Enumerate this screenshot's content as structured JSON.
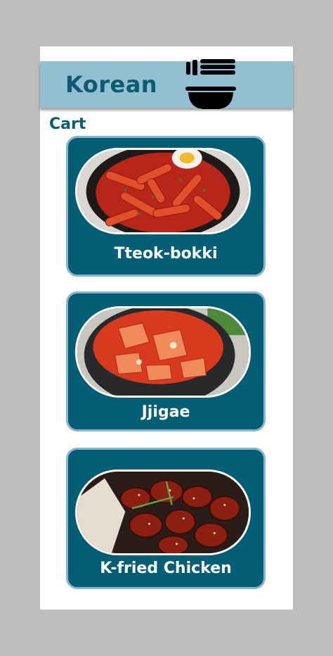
{
  "app": {
    "title": "Korean",
    "icon": "noodle-bowl-icon"
  },
  "cart": {
    "heading": "Cart",
    "items": [
      {
        "name": "Tteok-bokki",
        "image": "tteokbokki-photo"
      },
      {
        "name": "Jjigae",
        "image": "jjigae-photo"
      },
      {
        "name": "K-fried Chicken",
        "image": "fried-chicken-photo"
      }
    ]
  },
  "colors": {
    "header": "#93bfd2",
    "brand": "#0b5c72",
    "card": "#035e75",
    "card_border": "#85b6cd",
    "background": "#bdbdbd"
  }
}
